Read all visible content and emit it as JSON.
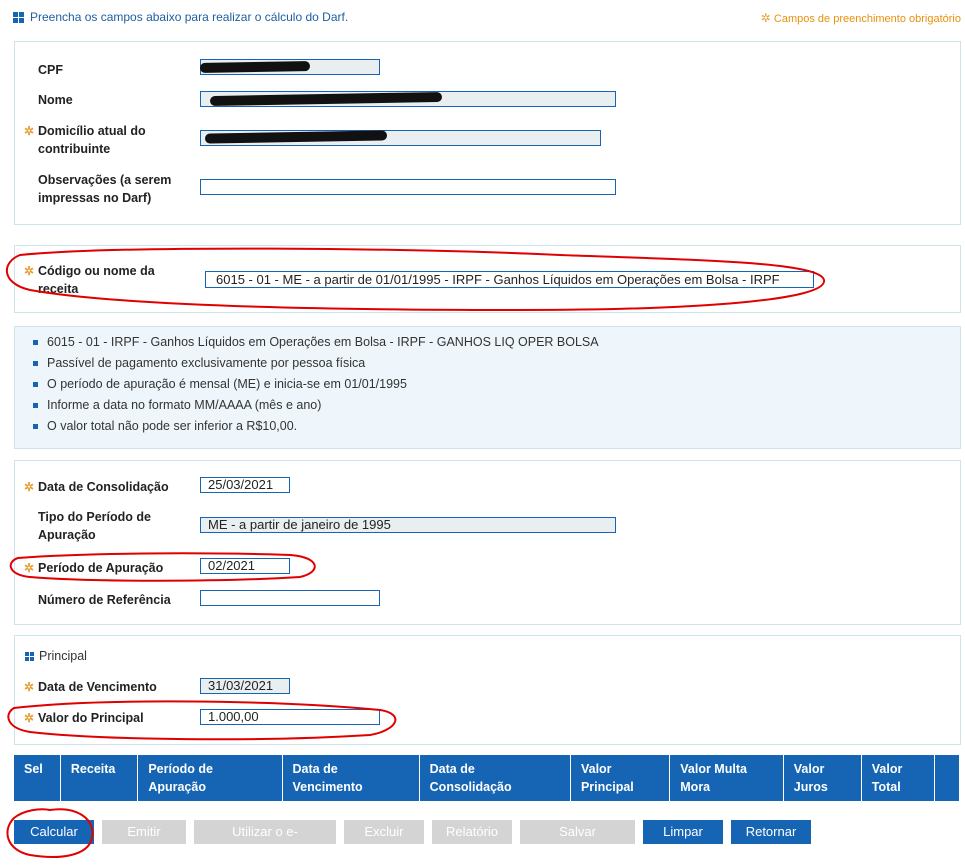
{
  "header": {
    "instruction": "Preencha os campos abaixo para realizar o cálculo do Darf.",
    "required_note": "Campos de preenchimento obrigatório"
  },
  "contributor": {
    "cpf_label": "CPF",
    "nome_label": "Nome",
    "domicilio_label": "Domicílio atual do contribuinte",
    "obs_label": "Observações (a serem impressas no Darf)",
    "obs_value": ""
  },
  "receita": {
    "label": "Código ou nome da receita",
    "value": "6015 - 01 - ME - a partir de 01/01/1995 - IRPF - Ganhos Líquidos em Operações em Bolsa - IRPF"
  },
  "info_items": [
    "6015 - 01 - IRPF - Ganhos Líquidos em Operações em Bolsa - IRPF - GANHOS LIQ OPER BOLSA",
    "Passível de pagamento exclusivamente por pessoa física",
    "O período de apuração é mensal (ME) e inicia-se em 01/01/1995",
    "Informe a data no formato MM/AAAA (mês e ano)",
    "O valor total não pode ser inferior a R$10,00."
  ],
  "periodo": {
    "consolidacao_label": "Data de Consolidação",
    "consolidacao_value": "25/03/2021",
    "tipo_label": "Tipo do Período de Apuração",
    "tipo_value": "ME - a partir de janeiro de 1995",
    "apuracao_label": "Período de Apuração",
    "apuracao_value": "02/2021",
    "referencia_label": "Número de Referência",
    "referencia_value": ""
  },
  "principal": {
    "title": "Principal",
    "vencimento_label": "Data de Vencimento",
    "vencimento_value": "31/03/2021",
    "valor_label": "Valor do Principal",
    "valor_value": "1.000,00"
  },
  "table_headers": [
    "Sel",
    "Receita",
    "Período de Apuração",
    "Data de Vencimento",
    "Data de Consolidação",
    "Valor Principal",
    "Valor Multa Mora",
    "Valor Juros",
    "Valor Total",
    ""
  ],
  "buttons": {
    "calcular": "Calcular",
    "emitir": "Emitir Darf",
    "utilizar": "Utilizar o e-Arrecada",
    "excluir": "Excluir",
    "relatorio": "Relatório",
    "salvar": "Salvar Trabalho",
    "limpar": "Limpar",
    "retornar": "Retornar"
  },
  "colors": {
    "accent": "#1565b4",
    "required": "#e8a23a",
    "annotation": "#e00000",
    "disabled": "#d4d4d4"
  }
}
